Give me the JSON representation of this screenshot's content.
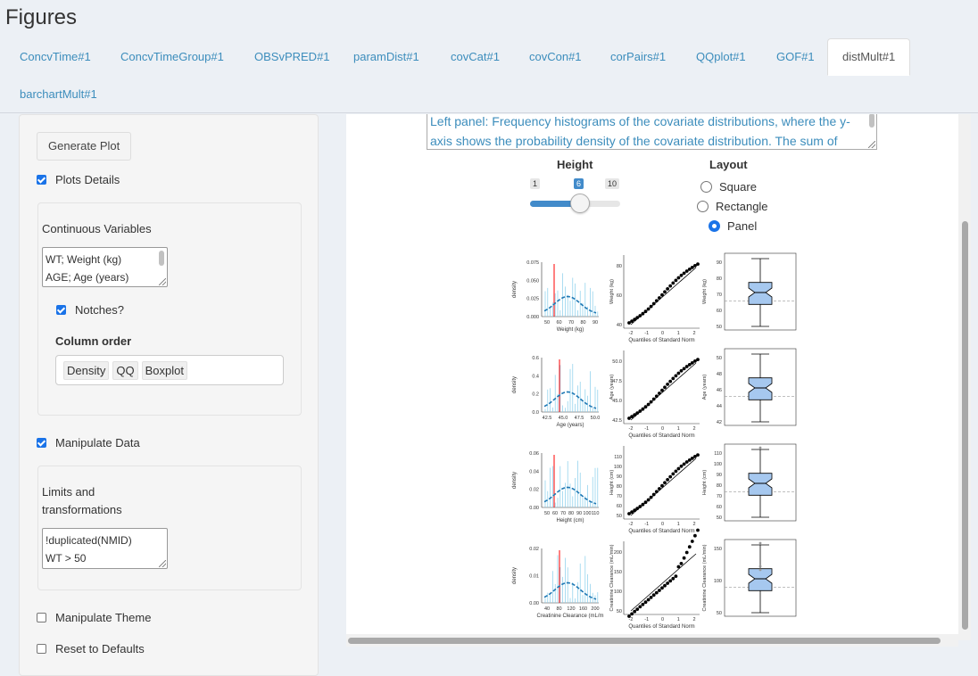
{
  "page": {
    "title": "Figures"
  },
  "tabs": [
    {
      "label": "ConcvTime#1"
    },
    {
      "label": "ConcvTimeGroup#1"
    },
    {
      "label": "OBSvPRED#1"
    },
    {
      "label": "paramDist#1"
    },
    {
      "label": "covCat#1"
    },
    {
      "label": "covCon#1"
    },
    {
      "label": "corPairs#1"
    },
    {
      "label": "QQplot#1"
    },
    {
      "label": "GOF#1"
    },
    {
      "label": "distMult#1"
    },
    {
      "label": "barchartMult#1"
    }
  ],
  "active_tab": "distMult#1",
  "sidebar": {
    "generate_label": "Generate Plot",
    "plots_details": {
      "label": "Plots Details",
      "checked": true
    },
    "continuous_variables": {
      "label": "Continuous Variables",
      "lines": [
        "WT; Weight (kg)",
        "AGE; Age (years)"
      ]
    },
    "notches": {
      "label": "Notches?",
      "checked": true
    },
    "column_order": {
      "label": "Column order",
      "items": [
        "Density",
        "QQ",
        "Boxplot"
      ]
    },
    "manipulate_data": {
      "label": "Manipulate Data",
      "checked": true
    },
    "limits": {
      "label_line1": "Limits and",
      "label_line2": "transformations",
      "lines": [
        "!duplicated(NMID)",
        "WT > 50"
      ]
    },
    "manipulate_theme": {
      "label": "Manipulate Theme",
      "checked": false
    },
    "reset_defaults": {
      "label": "Reset to Defaults",
      "checked": false
    }
  },
  "main": {
    "description_lines": [
      "Left panel: Frequency histograms of the covariate distributions, where the y-",
      "axis shows the probability density of the covariate distribution. The sum of"
    ],
    "height": {
      "label": "Height",
      "min": "1",
      "max": "10",
      "value": "6",
      "fraction": 0.5556
    },
    "layout": {
      "label": "Layout",
      "options": [
        "Square",
        "Rectangle",
        "Panel"
      ],
      "selected": "Panel"
    }
  },
  "figure": {
    "colors": {
      "hist": "#87ceeb",
      "density": "#1f78b4",
      "ref_line": "#ff0000",
      "box_fill": "#a6c8ef"
    },
    "rows": [
      {
        "density_ylabel": "density",
        "density_xlabel": "Weight (kg)",
        "density_yticks": [
          "0.075",
          "0.050",
          "0.025",
          "0.000"
        ],
        "density_xticks": [
          "50",
          "60",
          "70",
          "80",
          "90"
        ],
        "qq_ylabel": "Weight (kg)",
        "qq_xlabel": "Quantiles of Standard Norm",
        "qq_yticks": [
          "80",
          "60",
          "40"
        ],
        "qq_xticks": [
          "-2",
          "-1",
          "0",
          "1",
          "2"
        ],
        "box_ylabel": "Weight (kg)",
        "box_yticks": [
          "90",
          "80",
          "70",
          "60",
          "50"
        ]
      },
      {
        "density_ylabel": "density",
        "density_xlabel": "Age (years)",
        "density_yticks": [
          "0.6",
          "0.4",
          "0.2",
          "0.0"
        ],
        "density_xticks": [
          "42.5",
          "45.0",
          "47.5",
          "50.0"
        ],
        "qq_ylabel": "Age (years)",
        "qq_xlabel": "Quantiles of Standard Norm",
        "qq_yticks": [
          "50.0",
          "47.5",
          "45.0",
          "42.5"
        ],
        "qq_xticks": [
          "-2",
          "-1",
          "0",
          "1",
          "2"
        ],
        "box_ylabel": "Age (years)",
        "box_yticks": [
          "50",
          "48",
          "46",
          "44",
          "42"
        ]
      },
      {
        "density_ylabel": "density",
        "density_xlabel": "Height (cm)",
        "density_yticks": [
          "0.06",
          "0.04",
          "0.02",
          "0.00"
        ],
        "density_xticks": [
          "50",
          "60",
          "70",
          "80",
          "90",
          "100",
          "110"
        ],
        "qq_ylabel": "Height (cm)",
        "qq_xlabel": "Quantiles of Standard Norm",
        "qq_yticks": [
          "110",
          "100",
          "90",
          "80",
          "70",
          "60",
          "50"
        ],
        "qq_xticks": [
          "-2",
          "-1",
          "0",
          "1",
          "2"
        ],
        "box_ylabel": "Height (cm)",
        "box_yticks": [
          "110",
          "100",
          "90",
          "80",
          "70",
          "60",
          "50"
        ]
      },
      {
        "density_ylabel": "density",
        "density_xlabel": "Creatinine Clearance (mL/m",
        "density_yticks": [
          "0.02",
          "0.01",
          "0.00"
        ],
        "density_xticks": [
          "40",
          "80",
          "120",
          "160",
          "200"
        ],
        "qq_ylabel": "Creatinine Clearance (mL/min)",
        "qq_xlabel": "Quantiles of Standard Norm",
        "qq_yticks": [
          "200",
          "150",
          "100",
          "50"
        ],
        "qq_xticks": [
          "-2",
          "-1",
          "0",
          "1",
          "2"
        ],
        "box_ylabel": "Creatinine Clearance (mL/min)",
        "box_yticks": [
          "150",
          "100",
          "50"
        ]
      }
    ]
  }
}
